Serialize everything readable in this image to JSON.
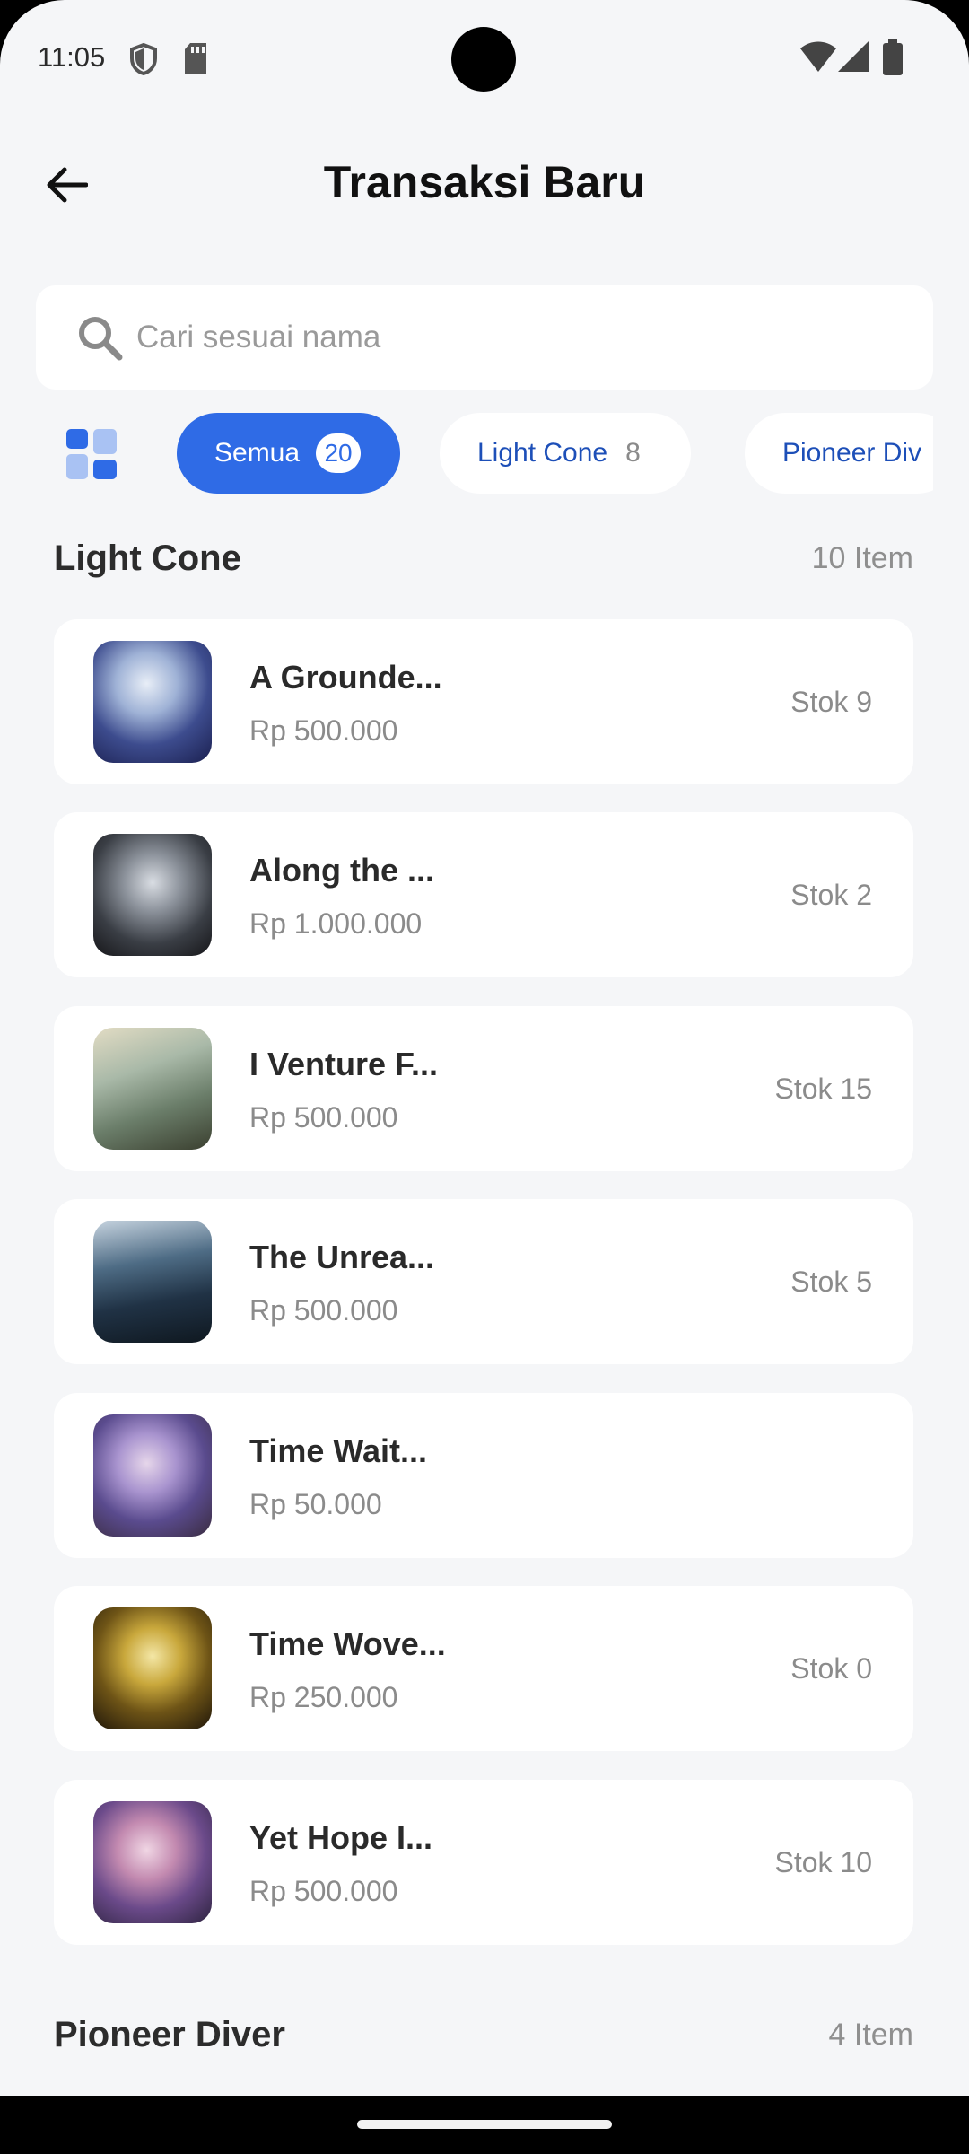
{
  "status_bar": {
    "time": "11:05",
    "icons": [
      "shield-icon",
      "sd-card-icon",
      "wifi-icon",
      "signal-icon",
      "battery-icon"
    ]
  },
  "header": {
    "title": "Transaksi Baru",
    "back_icon": "arrow-left-icon"
  },
  "search": {
    "placeholder": "Cari sesuai nama",
    "value": ""
  },
  "filters": [
    {
      "label": "Semua",
      "count": "20",
      "active": true
    },
    {
      "label": "Light Cone",
      "count": "8",
      "active": false
    },
    {
      "label": "Pioneer Div",
      "count": "",
      "active": false
    }
  ],
  "sections": [
    {
      "title": "Light Cone",
      "count_label": "10 Item",
      "items": [
        {
          "name": "A Grounde...",
          "price": "Rp 500.000",
          "stock": "Stok 9"
        },
        {
          "name": "Along the ...",
          "price": "Rp 1.000.000",
          "stock": "Stok 2"
        },
        {
          "name": "I Venture F...",
          "price": "Rp 500.000",
          "stock": "Stok 15"
        },
        {
          "name": "The Unrea...",
          "price": "Rp 500.000",
          "stock": "Stok 5"
        },
        {
          "name": "Time Wait...",
          "price": "Rp 50.000",
          "stock": ""
        },
        {
          "name": "Time Wove...",
          "price": "Rp 250.000",
          "stock": "Stok 0"
        },
        {
          "name": "Yet Hope I...",
          "price": "Rp 500.000",
          "stock": "Stok 10"
        }
      ]
    },
    {
      "title": "Pioneer Diver",
      "count_label": "4 Item",
      "items": []
    }
  ],
  "colors": {
    "accent": "#2f6be6",
    "chip_text": "#1d4fb8",
    "background": "#f5f6f8"
  }
}
